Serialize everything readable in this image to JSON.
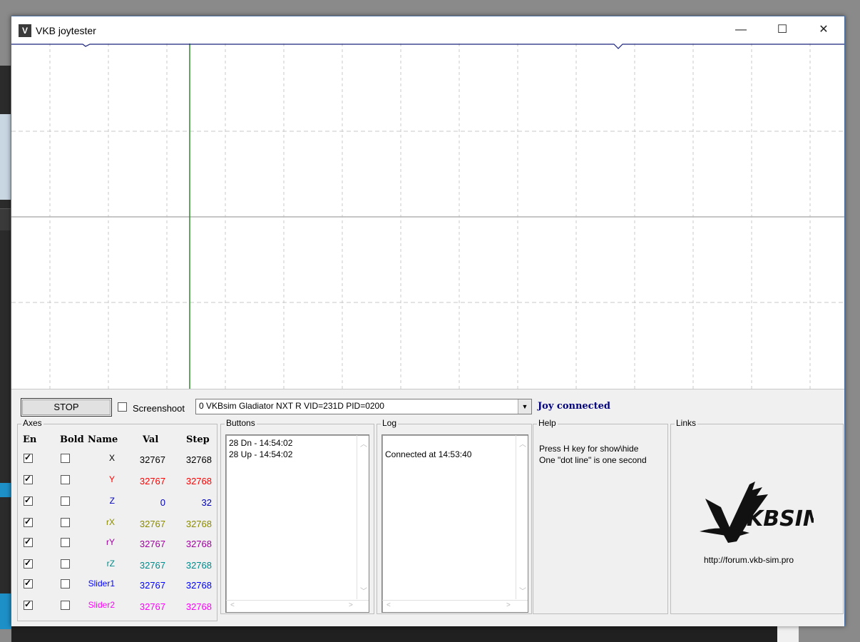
{
  "window": {
    "title": "VKB joytester",
    "min_glyph": "—",
    "max_glyph": "☐",
    "close_glyph": "✕"
  },
  "toolbar": {
    "stop_label": "STOP",
    "screenshoot_label": "Screenshoot",
    "device_selected": "0  VKBsim Gladiator NXT R   VID=231D PID=0200",
    "status": "Joy connected"
  },
  "axes": {
    "group_label": "Axes",
    "headers": {
      "en": "En",
      "bold": "Bold",
      "name": "Name",
      "val": "Val",
      "step": "Step"
    },
    "rows": [
      {
        "name": "X",
        "val": "32767",
        "step": "32768",
        "color": "#000000",
        "enabled": true,
        "bold": false
      },
      {
        "name": "Y",
        "val": "32767",
        "step": "32768",
        "color": "#ff0000",
        "enabled": true,
        "bold": false
      },
      {
        "name": "Z",
        "val": "0",
        "step": "32",
        "color": "#0000c0",
        "enabled": true,
        "bold": false
      },
      {
        "name": "rX",
        "val": "32767",
        "step": "32768",
        "color": "#8a8a00",
        "enabled": true,
        "bold": false
      },
      {
        "name": "rY",
        "val": "32767",
        "step": "32768",
        "color": "#a000a0",
        "enabled": true,
        "bold": false
      },
      {
        "name": "rZ",
        "val": "32767",
        "step": "32768",
        "color": "#008a8a",
        "enabled": true,
        "bold": false
      },
      {
        "name": "Slider1",
        "val": "32767",
        "step": "32768",
        "color": "#0000ff",
        "enabled": true,
        "bold": false
      },
      {
        "name": "Slider2",
        "val": "32767",
        "step": "32768",
        "color": "#ff00ff",
        "enabled": true,
        "bold": false
      }
    ]
  },
  "buttons": {
    "group_label": "Buttons",
    "lines": [
      "28 Dn - 14:54:02",
      "28 Up - 14:54:02"
    ]
  },
  "log": {
    "group_label": "Log",
    "lines": [
      "Connected at 14:53:40"
    ]
  },
  "help": {
    "group_label": "Help",
    "line1": "Press H key for show\\hide",
    "line2": "One \"dot line\" is one second"
  },
  "links": {
    "group_label": "Links",
    "url": "http://forum.vkb-sim.pro",
    "logo_text": "KBSIM"
  },
  "plot": {
    "grid_color": "#c8c8c8",
    "trace_color": "#1a237e",
    "cursor_color": "#2e8b2e"
  }
}
